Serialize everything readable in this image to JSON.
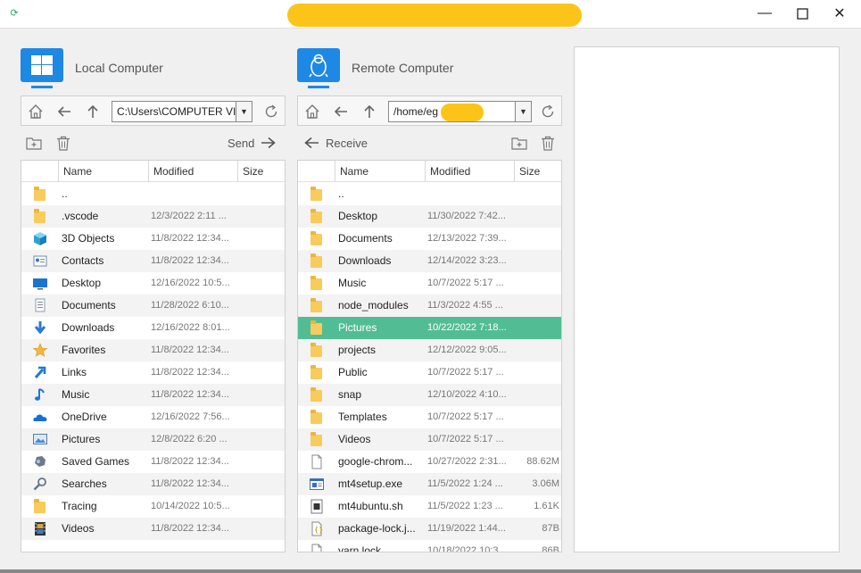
{
  "window": {
    "minimize_glyph": "—",
    "maximize_glyph": "☐",
    "close_glyph": "✕"
  },
  "local": {
    "title": "Local Computer",
    "path": "C:\\Users\\COMPUTER VIL",
    "send_label": "Send",
    "columns": [
      "Name",
      "Modified",
      "Size"
    ],
    "rows": [
      {
        "icon": "folder",
        "name": "..",
        "modified": "",
        "size": ""
      },
      {
        "icon": "folder",
        "name": ".vscode",
        "modified": "12/3/2022 2:11 ...",
        "size": ""
      },
      {
        "icon": "3d-objects-icon",
        "name": "3D Objects",
        "modified": "11/8/2022 12:34...",
        "size": ""
      },
      {
        "icon": "contacts-icon",
        "name": "Contacts",
        "modified": "11/8/2022 12:34...",
        "size": ""
      },
      {
        "icon": "desktop-icon",
        "name": "Desktop",
        "modified": "12/16/2022 10:5...",
        "size": ""
      },
      {
        "icon": "documents-icon",
        "name": "Documents",
        "modified": "11/28/2022 6:10...",
        "size": ""
      },
      {
        "icon": "downloads-icon",
        "name": "Downloads",
        "modified": "12/16/2022 8:01...",
        "size": ""
      },
      {
        "icon": "favorites-icon",
        "name": "Favorites",
        "modified": "11/8/2022 12:34...",
        "size": ""
      },
      {
        "icon": "links-icon",
        "name": "Links",
        "modified": "11/8/2022 12:34...",
        "size": ""
      },
      {
        "icon": "music-icon",
        "name": "Music",
        "modified": "11/8/2022 12:34...",
        "size": ""
      },
      {
        "icon": "onedrive-icon",
        "name": "OneDrive",
        "modified": "12/16/2022 7:56...",
        "size": ""
      },
      {
        "icon": "pictures-icon",
        "name": "Pictures",
        "modified": "12/8/2022 6:20 ...",
        "size": ""
      },
      {
        "icon": "saved-games-icon",
        "name": "Saved Games",
        "modified": "11/8/2022 12:34...",
        "size": ""
      },
      {
        "icon": "searches-icon",
        "name": "Searches",
        "modified": "11/8/2022 12:34...",
        "size": ""
      },
      {
        "icon": "folder",
        "name": "Tracing",
        "modified": "10/14/2022 10:5...",
        "size": ""
      },
      {
        "icon": "videos-icon",
        "name": "Videos",
        "modified": "11/8/2022 12:34...",
        "size": ""
      }
    ]
  },
  "remote": {
    "title": "Remote Computer",
    "path": "/home/eg",
    "receive_label": "Receive",
    "columns": [
      "Name",
      "Modified",
      "Size"
    ],
    "selected_row": "Pictures",
    "rows": [
      {
        "icon": "folder",
        "name": "..",
        "modified": "",
        "size": ""
      },
      {
        "icon": "folder",
        "name": "Desktop",
        "modified": "11/30/2022 7:42...",
        "size": ""
      },
      {
        "icon": "folder",
        "name": "Documents",
        "modified": "12/13/2022 7:39...",
        "size": ""
      },
      {
        "icon": "folder",
        "name": "Downloads",
        "modified": "12/14/2022 3:23...",
        "size": ""
      },
      {
        "icon": "folder",
        "name": "Music",
        "modified": "10/7/2022 5:17 ...",
        "size": ""
      },
      {
        "icon": "folder",
        "name": "node_modules",
        "modified": "11/3/2022 4:55 ...",
        "size": ""
      },
      {
        "icon": "folder",
        "name": "Pictures",
        "modified": "10/22/2022 7:18...",
        "size": ""
      },
      {
        "icon": "folder",
        "name": "projects",
        "modified": "12/12/2022 9:05...",
        "size": ""
      },
      {
        "icon": "folder",
        "name": "Public",
        "modified": "10/7/2022 5:17 ...",
        "size": ""
      },
      {
        "icon": "folder",
        "name": "snap",
        "modified": "12/10/2022 4:10...",
        "size": ""
      },
      {
        "icon": "folder",
        "name": "Templates",
        "modified": "10/7/2022 5:17 ...",
        "size": ""
      },
      {
        "icon": "folder",
        "name": "Videos",
        "modified": "10/7/2022 5:17 ...",
        "size": ""
      },
      {
        "icon": "file",
        "name": "google-chrom...",
        "modified": "10/27/2022 2:31...",
        "size": "88.62M"
      },
      {
        "icon": "exe",
        "name": "mt4setup.exe",
        "modified": "11/5/2022 1:24 ...",
        "size": "3.06M"
      },
      {
        "icon": "script",
        "name": "mt4ubuntu.sh",
        "modified": "11/5/2022 1:23 ...",
        "size": "1.61K"
      },
      {
        "icon": "json",
        "name": "package-lock.j...",
        "modified": "11/19/2022 1:44...",
        "size": "87B"
      },
      {
        "icon": "file",
        "name": "yarn.lock",
        "modified": "10/18/2022 10:3...",
        "size": "86B"
      }
    ]
  },
  "colors": {
    "accent": "#1e88e5",
    "selection": "#52bd94",
    "folder": "#f8cb5d",
    "redaction": "#fcc419"
  }
}
